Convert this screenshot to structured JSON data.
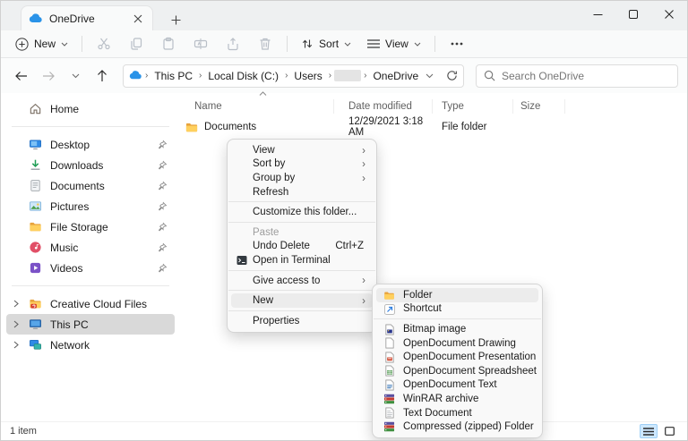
{
  "window": {
    "title": "OneDrive"
  },
  "tab": {
    "label": "OneDrive"
  },
  "toolbar": {
    "new_label": "New",
    "sort_label": "Sort",
    "view_label": "View"
  },
  "address": {
    "segments": [
      {
        "label": "This PC"
      },
      {
        "label": "Local Disk (C:)"
      },
      {
        "label": "Users"
      },
      {
        "label": "",
        "redacted": true
      },
      {
        "label": "OneDrive"
      }
    ]
  },
  "search": {
    "placeholder": "Search OneDrive"
  },
  "sidebar": {
    "home": {
      "label": "Home"
    },
    "pinned": [
      {
        "label": "Desktop"
      },
      {
        "label": "Downloads"
      },
      {
        "label": "Documents"
      },
      {
        "label": "Pictures"
      },
      {
        "label": "File Storage"
      },
      {
        "label": "Music"
      },
      {
        "label": "Videos"
      }
    ],
    "tree": [
      {
        "label": "Creative Cloud Files"
      },
      {
        "label": "This PC",
        "selected": true
      },
      {
        "label": "Network"
      }
    ]
  },
  "main": {
    "columns": [
      "Name",
      "Date modified",
      "Type",
      "Size"
    ],
    "rows": [
      {
        "name": "Documents",
        "date_modified": "12/29/2021 3:18 AM",
        "type": "File folder",
        "size": ""
      }
    ]
  },
  "context_menu": {
    "items": [
      {
        "label": "View"
      },
      {
        "label": "Sort by"
      },
      {
        "label": "Group by"
      },
      {
        "label": "Refresh"
      },
      {
        "label": "Customize this folder..."
      },
      {
        "label": "Paste",
        "disabled": true
      },
      {
        "label": "Undo Delete",
        "shortcut": "Ctrl+Z"
      },
      {
        "label": "Open in Terminal"
      },
      {
        "label": "Give access to"
      },
      {
        "label": "New",
        "highlighted": true
      },
      {
        "label": "Properties"
      }
    ]
  },
  "new_submenu": {
    "items": [
      {
        "label": "Folder",
        "highlighted": true
      },
      {
        "label": "Shortcut"
      },
      {
        "label": "Bitmap image"
      },
      {
        "label": "OpenDocument Drawing"
      },
      {
        "label": "OpenDocument Presentation"
      },
      {
        "label": "OpenDocument Spreadsheet"
      },
      {
        "label": "OpenDocument Text"
      },
      {
        "label": "WinRAR archive"
      },
      {
        "label": "Text Document"
      },
      {
        "label": "Compressed (zipped) Folder"
      }
    ]
  },
  "statusbar": {
    "items_count": "1 item"
  },
  "colors": {
    "accent_blue": "#2a93e8",
    "selection_gray": "#d9d9d9",
    "folder_yellow": "#ffd05e",
    "toggle_active_blue": "#cde8ff"
  }
}
